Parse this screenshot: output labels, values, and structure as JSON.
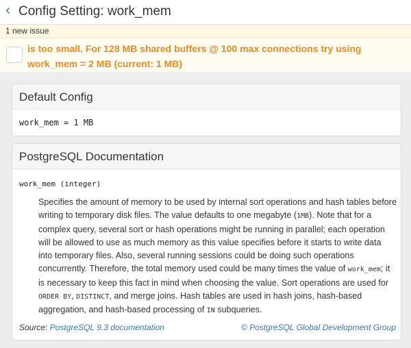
{
  "header": {
    "back_glyph": "‹",
    "title": "Config Setting: work_mem"
  },
  "issues": {
    "count_text": "1 new issue",
    "items": [
      {
        "text": "is too small. For 128 MB shared buffers @ 100 max connections try using work_mem = 2 MB (current: 1 MB)"
      }
    ]
  },
  "default_config": {
    "title": "Default Config",
    "value": "work_mem = 1 MB"
  },
  "docs": {
    "title": "PostgreSQL Documentation",
    "param": "work_mem (integer)",
    "body": [
      {
        "t": "Specifies the amount of memory to be used by internal sort operations and hash tables before writing to temporary disk files. The value defaults to one megabyte ("
      },
      {
        "c": "1MB"
      },
      {
        "t": "). Note that for a complex query, several sort or hash operations might be running in parallel; each operation will be allowed to use as much memory as this value specifies before it starts to write data into temporary files. Also, several running sessions could be doing such operations concurrently. Therefore, the total memory used could be many times the value of "
      },
      {
        "c": "work_mem"
      },
      {
        "t": "; it is necessary to keep this fact in mind when choosing the value. Sort operations are used for "
      },
      {
        "c": "ORDER BY"
      },
      {
        "t": ", "
      },
      {
        "c": "DISTINCT"
      },
      {
        "t": ", and merge joins. Hash tables are used in hash joins, hash-based aggregation, and hash-based processing of "
      },
      {
        "c": "IN"
      },
      {
        "t": " subqueries."
      }
    ],
    "source_label": "Source:",
    "source_link": "PostgreSQL 9.3 documentation",
    "copyright_link": "© PostgreSQL Global Development Group"
  }
}
